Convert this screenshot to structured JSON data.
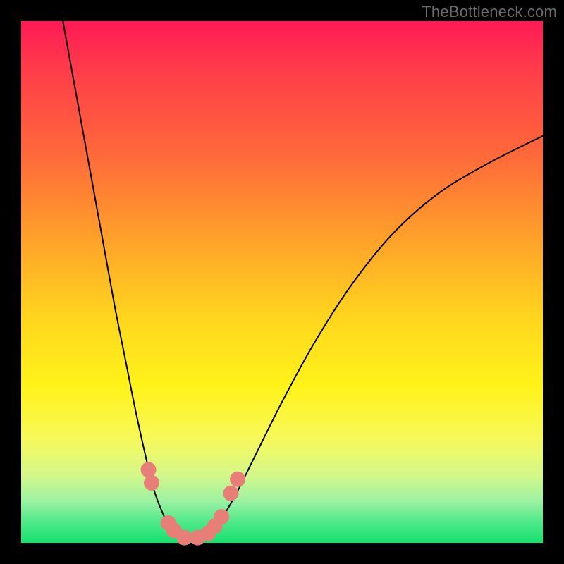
{
  "watermark": "TheBottleneck.com",
  "chart_data": {
    "type": "line",
    "title": "",
    "xlabel": "",
    "ylabel": "",
    "xlim": [
      0,
      100
    ],
    "ylim": [
      0,
      100
    ],
    "series": [
      {
        "name": "left-branch",
        "x": [
          8,
          10,
          12,
          14,
          16,
          18,
          20,
          22,
          24,
          25.5,
          27,
          28.5,
          30
        ],
        "y": [
          100,
          89,
          78,
          67,
          56,
          45,
          35,
          25,
          16,
          10,
          6,
          3,
          1.5
        ]
      },
      {
        "name": "right-branch",
        "x": [
          36,
          38,
          41,
          45,
          50,
          56,
          63,
          71,
          80,
          90,
          100
        ],
        "y": [
          1.5,
          4,
          9,
          17,
          27,
          38,
          49,
          59,
          67,
          73,
          78
        ]
      },
      {
        "name": "valley-floor",
        "x": [
          30,
          31,
          32.5,
          34,
          35,
          36
        ],
        "y": [
          1.5,
          1,
          0.8,
          0.9,
          1.1,
          1.5
        ]
      }
    ],
    "markers": [
      {
        "name": "left-upper-1",
        "x": 24.4,
        "y": 14.0
      },
      {
        "name": "left-upper-2",
        "x": 25.0,
        "y": 11.5
      },
      {
        "name": "left-lower-1",
        "x": 28.2,
        "y": 3.8
      },
      {
        "name": "left-lower-2",
        "x": 29.3,
        "y": 2.4
      },
      {
        "name": "valley-1",
        "x": 31.3,
        "y": 1.0
      },
      {
        "name": "valley-2",
        "x": 33.8,
        "y": 1.0
      },
      {
        "name": "right-lower-1",
        "x": 35.8,
        "y": 1.8
      },
      {
        "name": "right-lower-2",
        "x": 37.1,
        "y": 3.2
      },
      {
        "name": "right-lower-3",
        "x": 38.4,
        "y": 5.0
      },
      {
        "name": "right-upper-1",
        "x": 40.2,
        "y": 9.5
      },
      {
        "name": "right-upper-2",
        "x": 41.5,
        "y": 12.2
      }
    ],
    "colors": {
      "curve": "#000000",
      "marker": "#e77f78",
      "gradient_top": "#ff1955",
      "gradient_bottom": "#15e06f"
    }
  }
}
